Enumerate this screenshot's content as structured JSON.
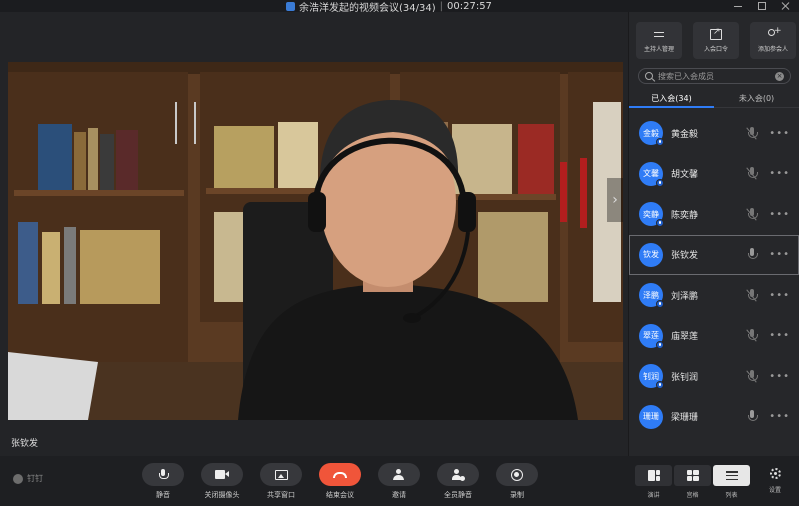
{
  "window": {
    "title": "余浩洋发起的视频会议(34/34)",
    "timer": "00:27:57"
  },
  "stage": {
    "speaker_name": "张钦发"
  },
  "sidebar": {
    "actions": [
      {
        "label": "主持人管理",
        "icon": "host-settings-icon"
      },
      {
        "label": "入会口令",
        "icon": "join-code-icon"
      },
      {
        "label": "添加参会人",
        "icon": "add-participant-icon"
      }
    ],
    "search": {
      "placeholder": "搜索已入会成员",
      "value": ""
    },
    "tabs": [
      {
        "label": "已入会(34)",
        "active": true
      },
      {
        "label": "未入会(0)",
        "active": false
      }
    ],
    "members": [
      {
        "avatar": "金毅",
        "name": "黄金毅",
        "mic": "off"
      },
      {
        "avatar": "文馨",
        "name": "胡文馨",
        "mic": "off"
      },
      {
        "avatar": "奕静",
        "name": "陈奕静",
        "mic": "off"
      },
      {
        "avatar": "钦发",
        "name": "张钦发",
        "mic": "on"
      },
      {
        "avatar": "泽鹏",
        "name": "刘泽鹏",
        "mic": "off"
      },
      {
        "avatar": "翠莲",
        "name": "庙翠莲",
        "mic": "off"
      },
      {
        "avatar": "钊润",
        "name": "张钊润",
        "mic": "off"
      },
      {
        "avatar": "珊珊",
        "name": "梁珊珊",
        "mic": "on"
      }
    ],
    "more_label": "•••"
  },
  "toolbar": {
    "brand": "钉钉",
    "mute": "静音",
    "camera_off": "关闭摄像头",
    "share": "共享窗口",
    "end": "结束会议",
    "invite": "邀请",
    "mute_all": "全员静音",
    "record": "录制",
    "layout_speaker": "演讲",
    "layout_grid": "宫格",
    "layout_list": "列表",
    "settings": "设置"
  },
  "colors": {
    "accent": "#2f7cf6",
    "end_call": "#f0553a",
    "background": "#232427"
  }
}
